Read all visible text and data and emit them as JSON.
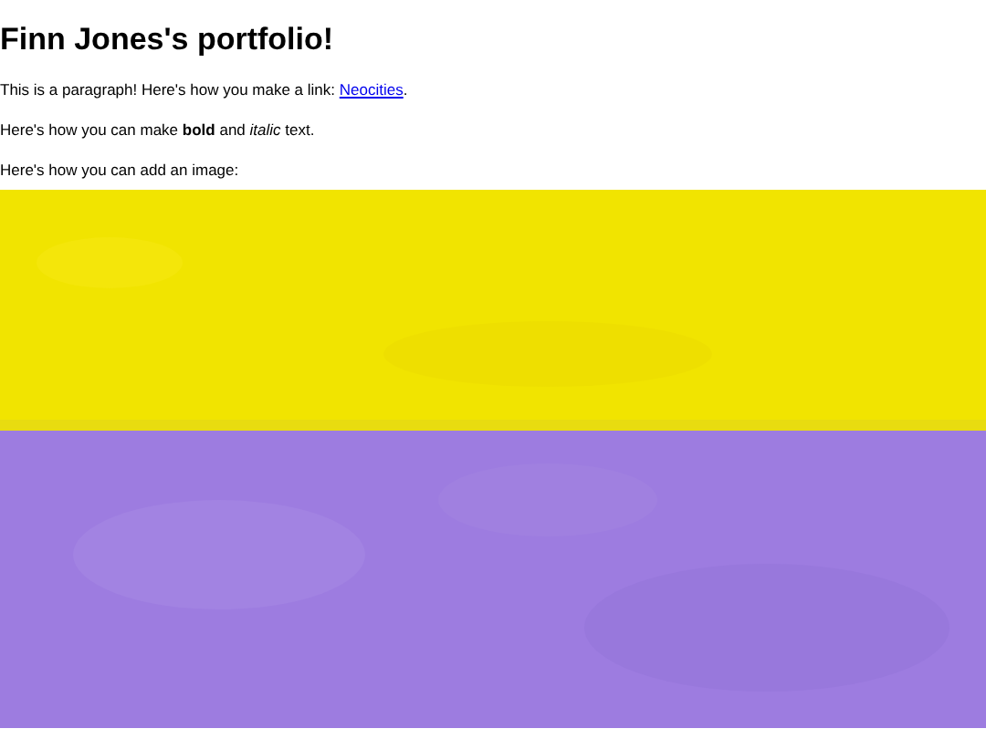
{
  "heading": "Finn Jones's portfolio!",
  "paragraphs": [
    {
      "text": "This is a paragraph! Here's how you make a link: ",
      "link": "Neocities",
      "after": "."
    },
    {
      "text": "Here's how you can make **bold** and *italic* text."
    },
    {
      "text": "Here's how you can add an image:"
    }
  ]
}
